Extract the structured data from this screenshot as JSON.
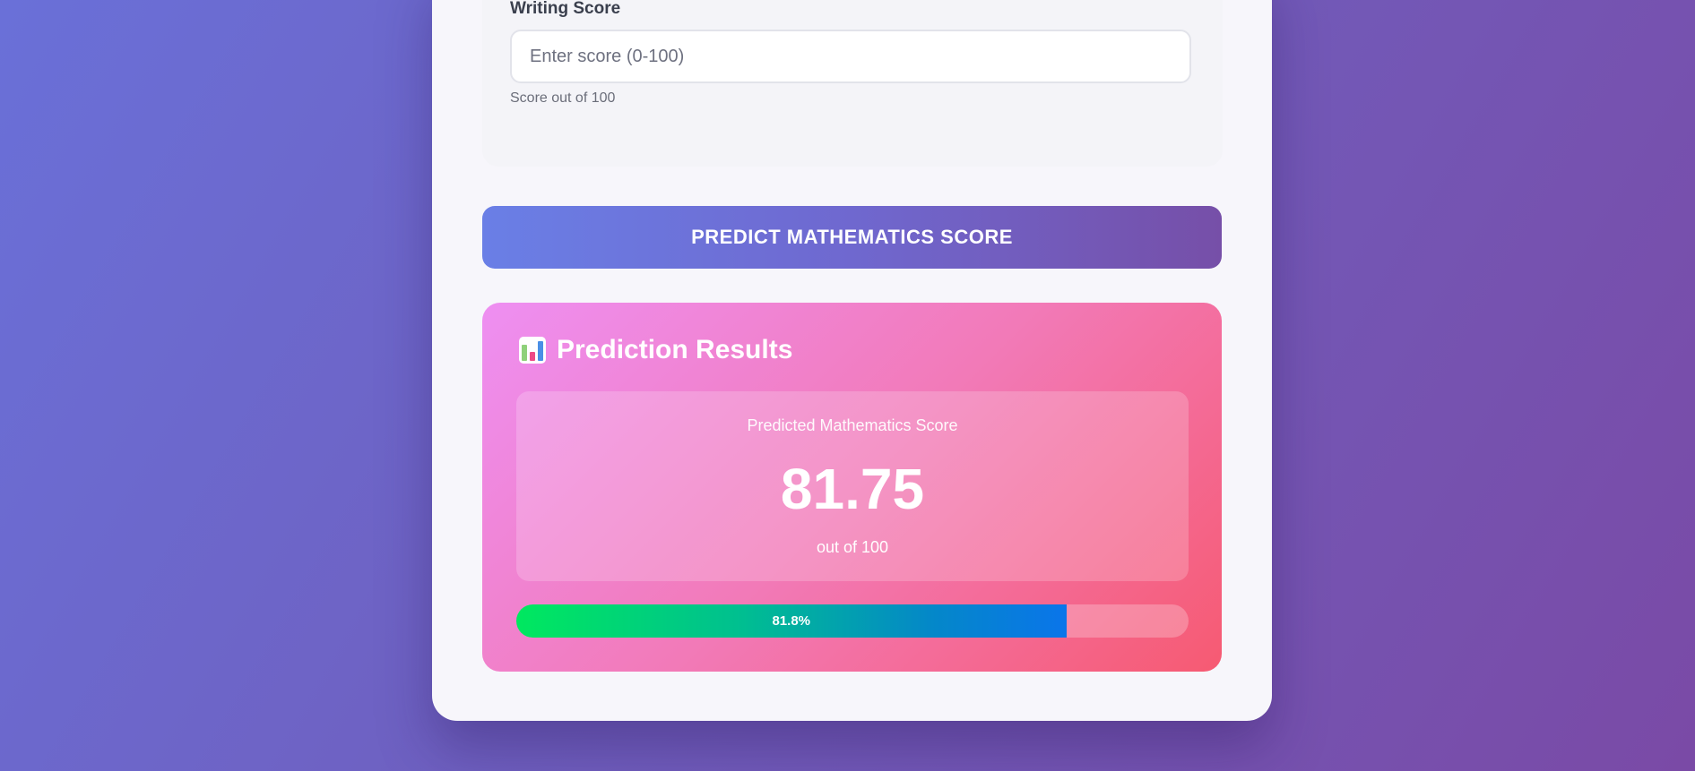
{
  "form": {
    "writing_score": {
      "label": "Writing Score",
      "value": "",
      "placeholder": "Enter score (0-100)",
      "helper": "Score out of 100"
    }
  },
  "predict_button": {
    "label": "PREDICT MATHEMATICS SCORE"
  },
  "results": {
    "icon": "bar-chart-icon",
    "title": "Prediction Results",
    "caption": "Predicted Mathematics Score",
    "score": "81.75",
    "out_of": "out of 100",
    "progress": {
      "percent": 81.8,
      "label": "81.8%"
    }
  },
  "colors": {
    "background_start": "#6a70d8",
    "background_end": "#7a4aa6",
    "button_start": "#6a7fe6",
    "button_end": "#764fa8",
    "results_start": "#ee8ff2",
    "results_end": "#f65a72",
    "progress_start": "#00e85f",
    "progress_end": "#0a75ea"
  }
}
